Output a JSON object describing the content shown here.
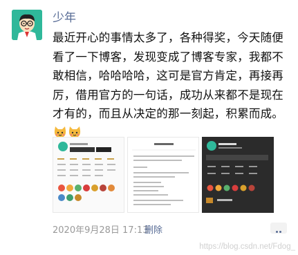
{
  "moment": {
    "username": "少年",
    "text": "最近开心的事情太多了，各种得奖，今天随便看了一下博客，发现变成了博客专家，我都不敢相信，哈哈哈哈，这可是官方肯定，再接再厉，借用官方的一句话，成功从来都不是现在才有的，而且从决定的那一刻起，积累而成。",
    "emojis": [
      "cat-emoji",
      "cat-emoji"
    ],
    "images": [
      "blog-profile-screenshot",
      "blog-expert-notice-screenshot",
      "blog-dark-profile-screenshot"
    ],
    "timestamp": "2020年9月28日 17:13",
    "delete_label": "删除"
  },
  "watermark": "https://blog.csdn.net/Fdog_",
  "colors": {
    "link": "#576b95",
    "avatar_bg": "#2fb89a",
    "text": "#111111",
    "meta": "#999999"
  }
}
